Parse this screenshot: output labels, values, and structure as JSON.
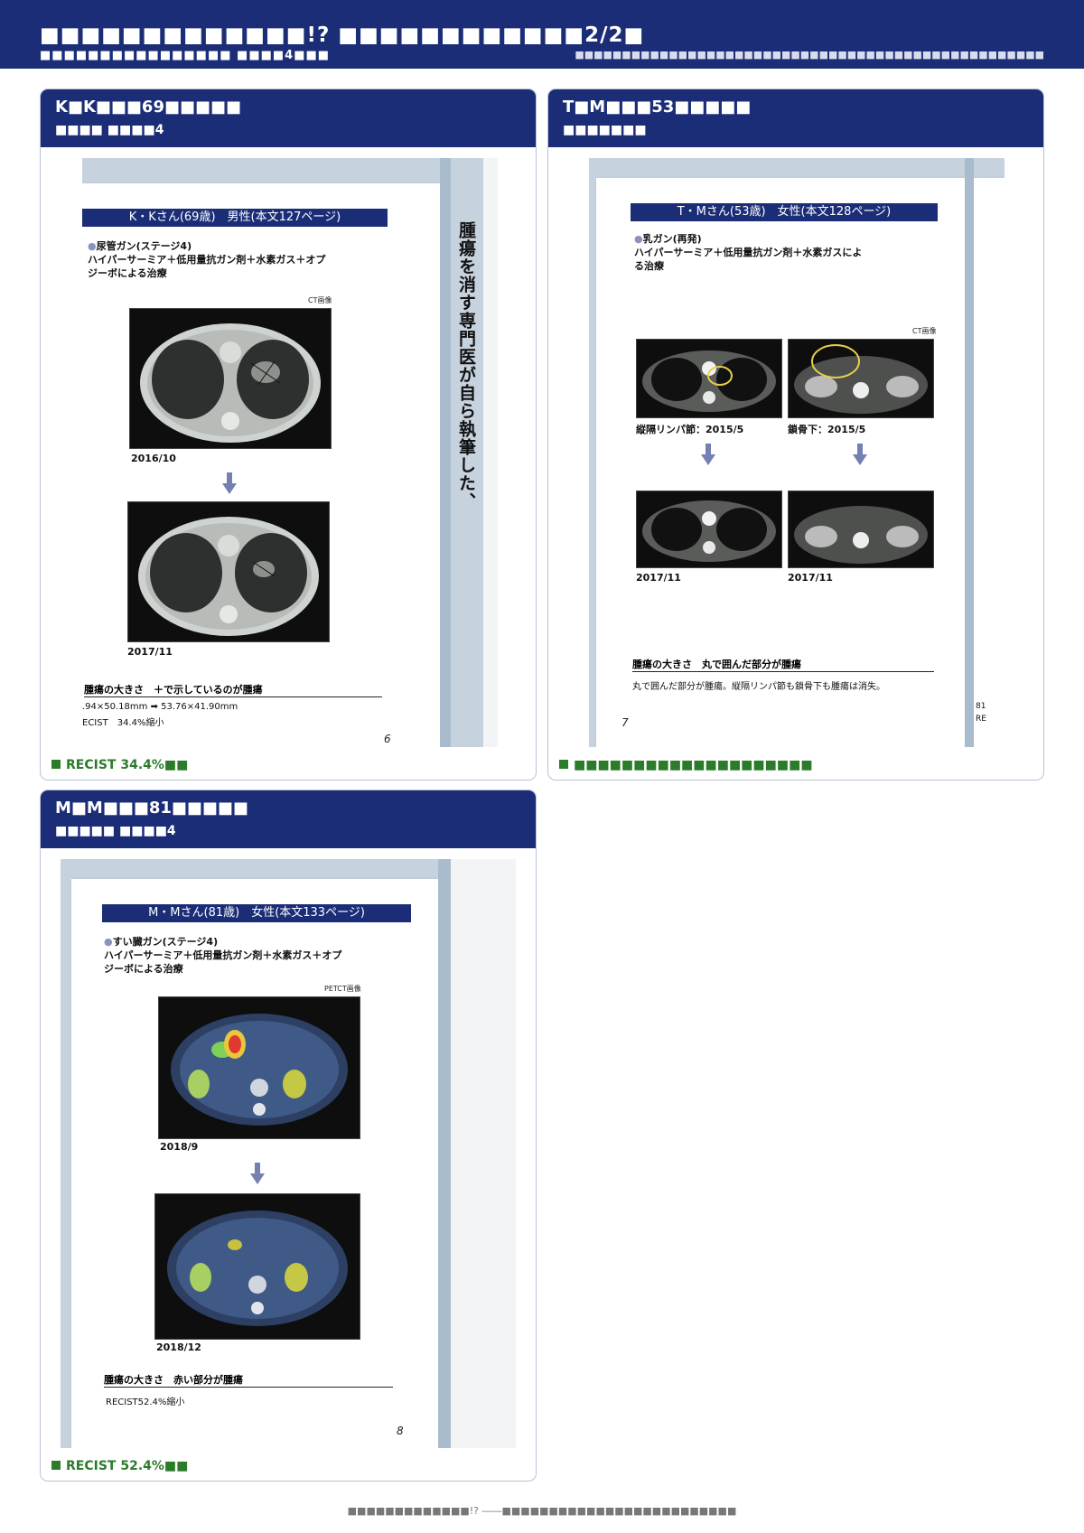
{
  "header": {
    "title": "■■■■■■■■■■■■■!? ■■■■■■■■■■■■2/2■",
    "subtitle": "■■■■■■■■■■■■■■■■ ■■■■4■■■",
    "right_text": "■■■■■■■■■■■■■■■■■■■■■■■■■■■■■■■■■■■■■■■■■■■■■■■■■■"
  },
  "cases": [
    {
      "name": "K■K■■■69■■■■■",
      "diagnosis": "■■■■ ■■■■4",
      "note": "RECIST 34.4%■■",
      "page": {
        "band": "K・Kさん(69歳)　男性(本文127ページ)",
        "diagnosis": "尿管ガン(ステージ4)",
        "treatment": "ハイパーサーミア＋低用量抗ガン剤＋水素ガス＋オプジーボによる治療",
        "image_type": "CT画像",
        "dates": [
          "2016/10",
          "2017/11"
        ],
        "caption": "腫瘍の大きさ　＋で示しているのが腫瘍",
        "measurement": ".94×50.18mm ➡ 53.76×41.90mm",
        "recist": "ECIST　34.4%縮小",
        "page_no": "6",
        "spine_text": "腫瘍を消す専門医が自ら執筆した、"
      }
    },
    {
      "name": "T■M■■■53■■■■■",
      "diagnosis": "■■■■■■■",
      "note": "■■■■■■■■■■■■■■■■■■■■",
      "page": {
        "band": "T・Mさん(53歳)　女性(本文128ページ)",
        "diagnosis": "乳ガン(再発)",
        "treatment": "ハイパーサーミア＋低用量抗ガン剤＋水素ガスによる治療",
        "image_type": "CT画像",
        "dates_before": [
          "縦隔リンパ節：2015/5",
          "鎖骨下：2015/5"
        ],
        "dates_after": [
          "2017/11",
          "2017/11"
        ],
        "caption": "腫瘍の大きさ　丸で囲んだ部分が腫瘍",
        "result": "丸で囲んだ部分が腫瘍。縦隔リンパ節も鎖骨下も腫瘍は消失。",
        "page_no": "7",
        "edge_text": [
          "81",
          "RE"
        ]
      }
    },
    {
      "name": "M■M■■■81■■■■■",
      "diagnosis": "■■■■■ ■■■■4",
      "note": "RECIST 52.4%■■",
      "page": {
        "band": "M・Mさん(81歳)　女性(本文133ページ)",
        "diagnosis": "すい臓ガン(ステージ4)",
        "treatment": "ハイパーサーミア＋低用量抗ガン剤＋水素ガス＋オプジーボによる治療",
        "image_type": "PETCT画像",
        "dates": [
          "2018/9",
          "2018/12"
        ],
        "caption": "腫瘍の大きさ　赤い部分が腫瘍",
        "recist": "RECIST52.4%縮小",
        "page_no": "8"
      }
    }
  ],
  "footer": "■■■■■■■■■■■■■!? ――■■■■■■■■■■■■■■■■■■■■■■■■■",
  "colors": {
    "navy": "#1b2d77",
    "green": "#2b7b2b",
    "arrow": "#747fb2"
  }
}
